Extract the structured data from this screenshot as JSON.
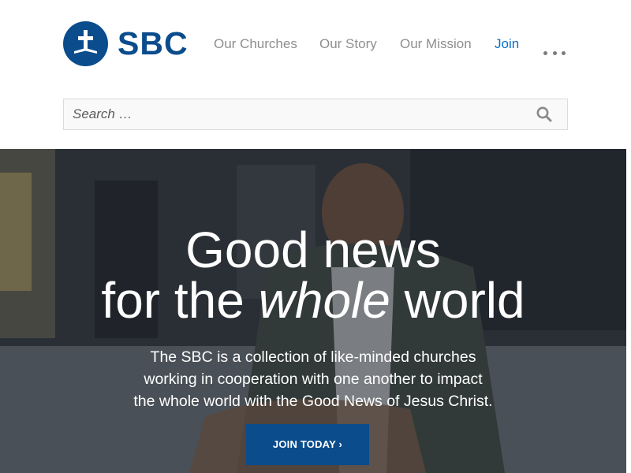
{
  "brand": {
    "name": "SBC",
    "logo_icon": "cross-emblem-icon",
    "primary_color": "#0a4c8c",
    "link_active_color": "#0a6fc7"
  },
  "nav": {
    "items": [
      {
        "label": "Our Churches"
      },
      {
        "label": "Our Story"
      },
      {
        "label": "Our Mission"
      },
      {
        "label": "Join",
        "active": true
      }
    ],
    "more_icon": "ellipsis-icon"
  },
  "search": {
    "placeholder": "Search …",
    "icon": "search-icon"
  },
  "hero": {
    "title_line1": "Good news",
    "title_line2_before": "for the ",
    "title_line2_emphasis": "whole",
    "title_line2_after": " world",
    "description_line1": "The SBC is a collection of like-minded churches",
    "description_line2": "working in cooperation with one another to impact",
    "description_line3": "the whole world with the Good News of Jesus Christ.",
    "cta_label": "JOIN TODAY ›"
  }
}
